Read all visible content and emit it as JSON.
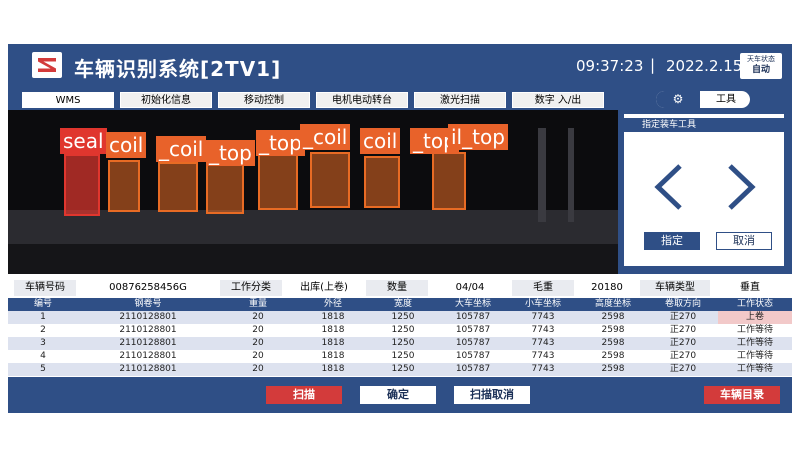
{
  "header": {
    "title": "车辆识别系统[2TV1]",
    "time": "09:37:23",
    "separator": "|",
    "date": "2022.2.15",
    "state_label": "天车状态",
    "state_value": "自动"
  },
  "tabs": [
    {
      "label": "WMS",
      "active": true
    },
    {
      "label": "初始化信息"
    },
    {
      "label": "移动控制"
    },
    {
      "label": "电机电动转台"
    },
    {
      "label": "激光扫描"
    },
    {
      "label": "数字 入/出"
    }
  ],
  "tools": {
    "icon": "gear-icon",
    "label": "工具"
  },
  "camera": {
    "detections": [
      {
        "label": "seal",
        "color": "red"
      },
      {
        "label": "coil",
        "color": "orange"
      },
      {
        "label": "_coil",
        "color": "orange"
      },
      {
        "label": "_top",
        "color": "orange"
      },
      {
        "label": "_top",
        "color": "orange"
      },
      {
        "label": "_coil",
        "color": "orange"
      },
      {
        "label": "coil",
        "color": "orange"
      },
      {
        "label": "_top",
        "color": "orange"
      },
      {
        "label": "il_top",
        "color": "orange"
      }
    ]
  },
  "side_panel": {
    "title": "指定装车工具",
    "prev_icon": "chevron-left-icon",
    "next_icon": "chevron-right-icon",
    "assign_label": "指定",
    "cancel_label": "取消"
  },
  "vehicle_info": {
    "vehicle_no_label": "车辆号码",
    "vehicle_no": "00876258456G",
    "work_type_label": "工作分类",
    "work_type": "出库(上卷)",
    "qty_label": "数量",
    "qty": "04/04",
    "gross_label": "毛重",
    "gross": "20180",
    "vehicle_type_label": "车辆类型",
    "vehicle_type": "垂直"
  },
  "table": {
    "headers": [
      "编号",
      "钢卷号",
      "重量",
      "外径",
      "宽度",
      "大车坐标",
      "小车坐标",
      "高度坐标",
      "卷取方向",
      "工作状态"
    ],
    "rows": [
      [
        "1",
        "2110128801",
        "20",
        "1818",
        "1250",
        "105787",
        "7743",
        "2598",
        "正270",
        "上卷"
      ],
      [
        "2",
        "2110128801",
        "20",
        "1818",
        "1250",
        "105787",
        "7743",
        "2598",
        "正270",
        "工作等待"
      ],
      [
        "3",
        "2110128801",
        "20",
        "1818",
        "1250",
        "105787",
        "7743",
        "2598",
        "正270",
        "工作等待"
      ],
      [
        "4",
        "2110128801",
        "20",
        "1818",
        "1250",
        "105787",
        "7743",
        "2598",
        "正270",
        "工作等待"
      ],
      [
        "5",
        "2110128801",
        "20",
        "1818",
        "1250",
        "105787",
        "7743",
        "2598",
        "正270",
        "工作等待"
      ]
    ]
  },
  "bottom_bar": {
    "scan_label": "扫描",
    "confirm_label": "确定",
    "scan_cancel_label": "扫描取消",
    "vehicle_list_label": "车辆目录"
  },
  "colors": {
    "primary": "#2f4f86",
    "danger": "#d33b3b",
    "detect_orange": "#e86b24",
    "detect_red": "#e0362e"
  }
}
